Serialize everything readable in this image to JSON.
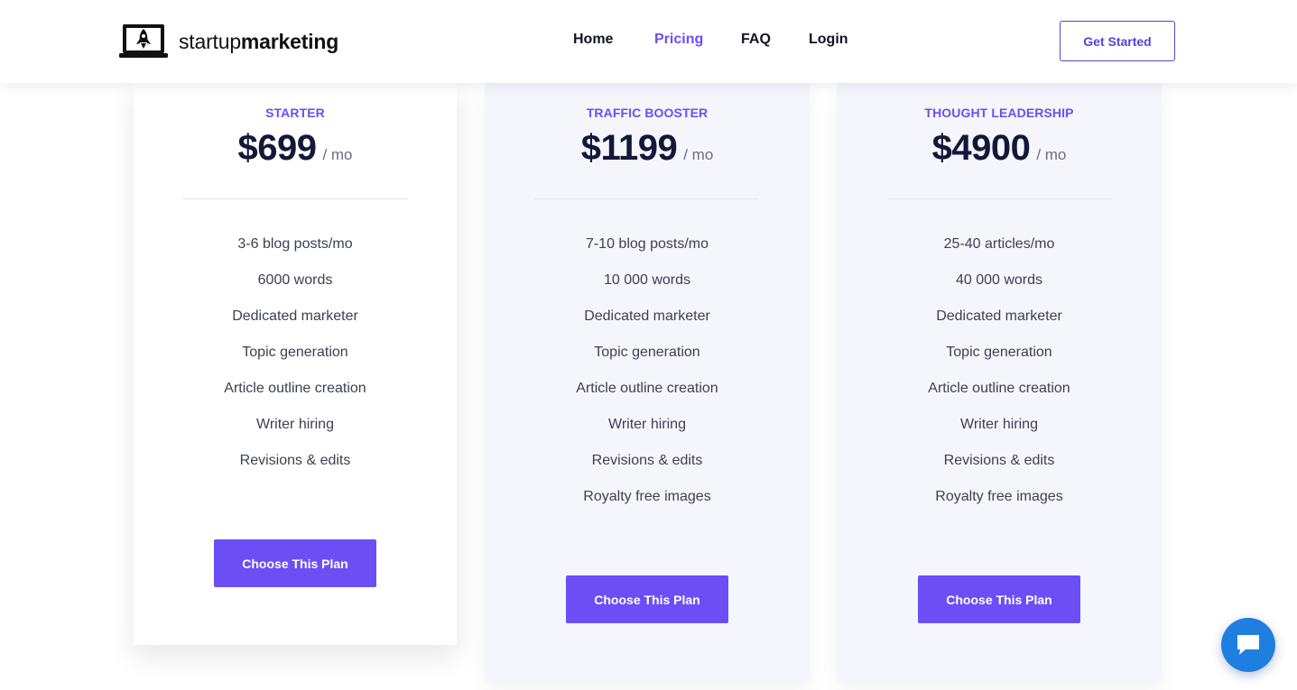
{
  "header": {
    "logo": {
      "regular": "startup",
      "bold": "marketing"
    },
    "nav": [
      {
        "label": "Home",
        "active": false
      },
      {
        "label": "Pricing",
        "active": true
      },
      {
        "label": "FAQ",
        "active": false
      },
      {
        "label": "Login",
        "active": false
      }
    ],
    "cta_label": "Get Started"
  },
  "plans": [
    {
      "name": "STARTER",
      "price": "$699",
      "period": "/ mo",
      "features": [
        "3-6 blog posts/mo",
        "6000 words",
        "Dedicated marketer",
        "Topic generation",
        "Article outline creation",
        "Writer hiring",
        "Revisions & edits"
      ],
      "button_label": "Choose This Plan"
    },
    {
      "name": "TRAFFIC BOOSTER",
      "price": "$1199",
      "period": "/ mo",
      "features": [
        "7-10 blog posts/mo",
        "10 000 words",
        "Dedicated marketer",
        "Topic generation",
        "Article outline creation",
        "Writer hiring",
        "Revisions & edits",
        "Royalty free images"
      ],
      "button_label": "Choose This Plan"
    },
    {
      "name": "THOUGHT LEADERSHIP",
      "price": "$4900",
      "period": "/ mo",
      "features": [
        "25-40 articles/mo",
        "40 000 words",
        "Dedicated marketer",
        "Topic generation",
        "Article outline creation",
        "Writer hiring",
        "Revisions & edits",
        "Royalty free images"
      ],
      "button_label": "Choose This Plan"
    }
  ],
  "colors": {
    "accent": "#6c4ef5",
    "heading": "#141838",
    "chat": "#1f7fe0"
  },
  "chat_icon": "chat-bubble-icon"
}
